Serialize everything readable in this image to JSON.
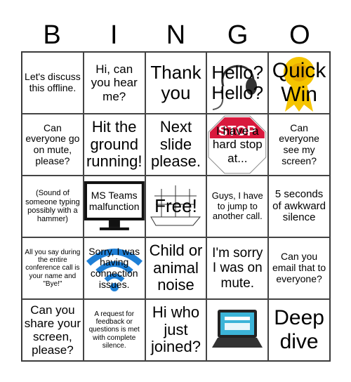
{
  "header": [
    "B",
    "I",
    "N",
    "G",
    "O"
  ],
  "cells": [
    "Let's discuss this offline.",
    "Hi, can you hear me?",
    "Thank you",
    "Hello? Hello?",
    "Quick Win",
    "Can everyone go on mute, please?",
    "Hit the ground running!",
    "Next slide please.",
    "I have a hard stop at...",
    "Can everyone see my screen?",
    "(Sound of someone typing possibly with a hammer)",
    "MS Teams malfunction",
    "Free!",
    "Guys, I have to jump to another call.",
    "5 seconds of awkward silence",
    "All you say during the entire conference call is your name and \"Bye!\"",
    "Sorry, I was having connection issues.",
    "Child or animal noise",
    "I'm sorry I was on mute.",
    "Can you email that to everyone?",
    "Can you share your screen, please?",
    "A request for feedback or questions is met with complete silence.",
    "Hi who just joined?",
    "",
    "Deep dive"
  ],
  "images": {
    "stop_sign_text": "STOP",
    "stop_color": "#d9193d",
    "ribbon_color": "#f5c400",
    "wifi_color": "#1e7fd6"
  }
}
